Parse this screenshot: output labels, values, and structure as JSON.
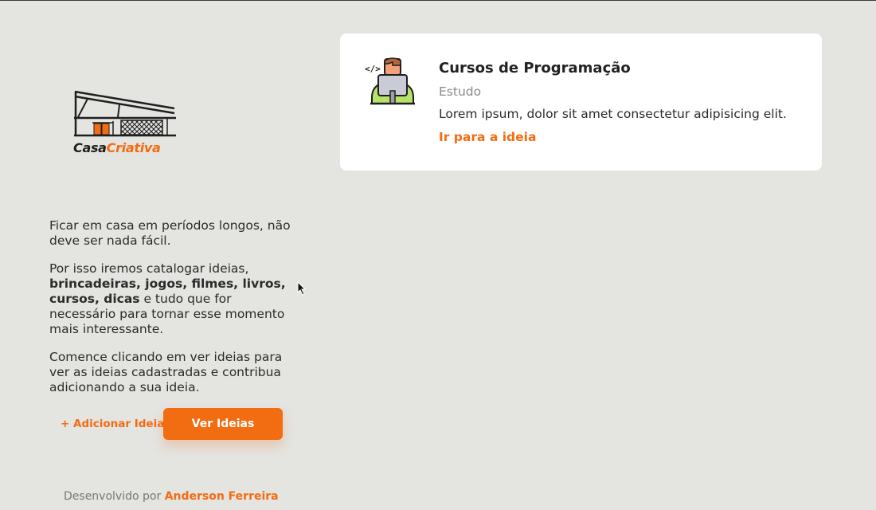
{
  "brand": {
    "word_part1": "Casa",
    "word_part2": "Criativa",
    "accent_color": "#f26c12"
  },
  "intro": {
    "p1": "Ficar em casa em períodos longos, não deve ser nada fácil.",
    "p2_start": "Por isso iremos catalogar ideias, ",
    "p2_bold": "brincadeiras, jogos, filmes, livros, cursos, dicas",
    "p2_end": " e tudo que for necessário para tornar esse momento mais interessante.",
    "p3": "Comence clicando em ver ideias para ver as ideias cadastradas e contribua adicionando a sua ideia."
  },
  "actions": {
    "add_label": "+ Adicionar Ideia",
    "view_label": "Ver Ideias"
  },
  "footer": {
    "prefix": "Desenvolvido por",
    "author": "Anderson Ferreira"
  },
  "ideas": [
    {
      "title": "Cursos de Programação",
      "category": "Estudo",
      "description": "Lorem ipsum, dolor sit amet consectetur adipisicing elit.",
      "link_label": "Ir para a ideia",
      "icon": "programmer-icon"
    }
  ]
}
